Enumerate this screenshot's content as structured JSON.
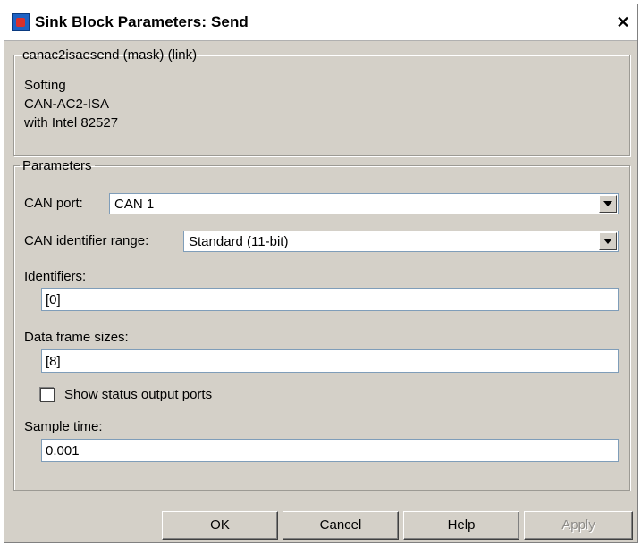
{
  "window": {
    "title": "Sink Block Parameters: Send",
    "close_glyph": "✕"
  },
  "description_group": {
    "legend": "canac2isaesend (mask) (link)",
    "lines": [
      "Softing",
      "CAN-AC2-ISA",
      "with Intel 82527"
    ]
  },
  "parameters_group": {
    "legend": "Parameters",
    "can_port": {
      "label": "CAN port:",
      "value": "CAN 1"
    },
    "identifier_range": {
      "label": "CAN identifier range:",
      "value": "Standard (11-bit)"
    },
    "identifiers": {
      "label": "Identifiers:",
      "value": "[0]"
    },
    "frame_sizes": {
      "label": "Data frame sizes:",
      "value": "[8]"
    },
    "status_ports": {
      "label": "Show status output ports",
      "checked": false
    },
    "sample_time": {
      "label": "Sample time:",
      "value": "0.001"
    }
  },
  "buttons": {
    "ok": "OK",
    "cancel": "Cancel",
    "help": "Help",
    "apply": "Apply"
  }
}
